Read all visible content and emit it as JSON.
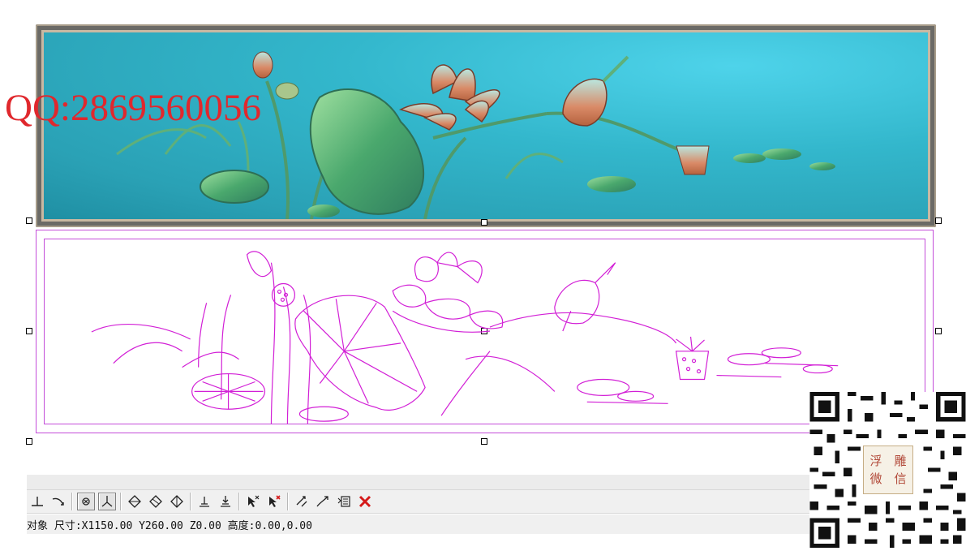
{
  "watermark": {
    "text": "QQ:2869560056"
  },
  "status_bar": {
    "text": "对象 尺寸:X1150.00 Y260.00 Z0.00 高度:0.00,0.00"
  },
  "toolbar": {
    "icons": [
      "perpendicular-icon",
      "curve-arrow-icon",
      "snap-point-icon",
      "snap-axis-icon",
      "node-diamond-icon",
      "node-diamond-alt-icon",
      "node-diamond-cross-icon",
      "align-bottom-icon",
      "align-bottom-arrow-icon",
      "select-add-icon",
      "select-remove-icon",
      "transform-node-icon",
      "edit-curve-icon",
      "list-edit-icon",
      "delete-icon"
    ],
    "pressed": [
      "snap-point-icon",
      "snap-axis-icon"
    ]
  },
  "qr_badge": {
    "chars": [
      "浮",
      "雕",
      "微",
      "信"
    ]
  },
  "colors": {
    "vector_stroke": "#d21fd6",
    "frame_stroke": "#c44dd9",
    "relief_bg": "#33b7cc",
    "watermark": "#e0282d",
    "delete_icon": "#d51a1a"
  }
}
